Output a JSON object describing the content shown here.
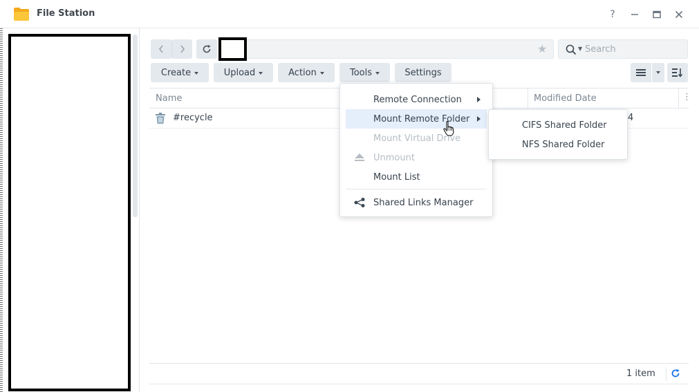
{
  "window": {
    "title": "File Station",
    "help": "?",
    "minimize": "—",
    "maximize": "□",
    "close": "✕"
  },
  "search": {
    "placeholder": "Search"
  },
  "toolbar": {
    "create": "Create",
    "upload": "Upload",
    "action": "Action",
    "tools": "Tools",
    "settings": "Settings"
  },
  "grid": {
    "columns": {
      "name": "Name",
      "modified": "Modified Date"
    },
    "rows": [
      {
        "name": "#recycle",
        "modified_partial": "4"
      }
    ]
  },
  "status": {
    "item_count": "1 item"
  },
  "tools_menu": {
    "items": [
      {
        "label": "Remote Connection",
        "submenu": true,
        "disabled": false
      },
      {
        "label": "Mount Remote Folder",
        "submenu": true,
        "disabled": false,
        "hover": true
      },
      {
        "label": "Mount Virtual Drive",
        "submenu": false,
        "disabled": true
      },
      {
        "label": "Unmount",
        "submenu": false,
        "disabled": true
      },
      {
        "label": "Mount List",
        "submenu": false,
        "disabled": false
      },
      {
        "label": "Shared Links Manager",
        "submenu": false,
        "disabled": false
      }
    ]
  },
  "mount_submenu": {
    "items": [
      {
        "label": "CIFS Shared Folder"
      },
      {
        "label": "NFS Shared Folder"
      }
    ]
  },
  "icons": {
    "app": "folder-icon",
    "recycle": "trash-icon",
    "accent": "#1a73e8"
  }
}
